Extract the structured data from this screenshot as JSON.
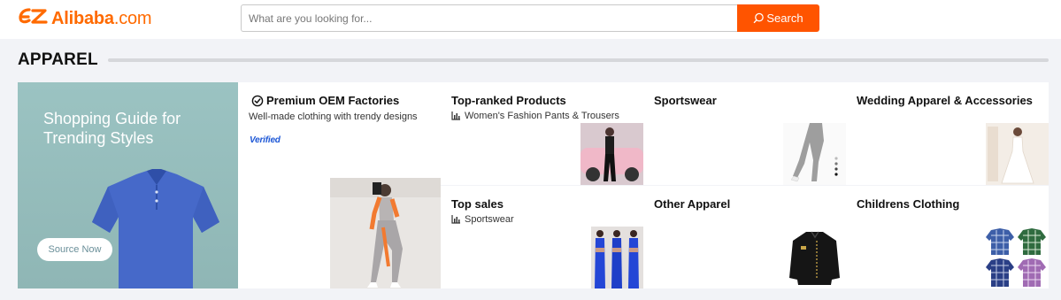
{
  "header": {
    "logo_mark": "Ɛ",
    "logo_name": "Alibaba",
    "logo_domain": ".com",
    "search_placeholder": "What are you looking for...",
    "search_button": "Search"
  },
  "section": {
    "title": "APPAREL"
  },
  "banner": {
    "title": "Shopping Guide for Trending Styles",
    "button": "Source Now"
  },
  "oem_card": {
    "title": "Premium OEM Factories",
    "subtitle": "Well-made clothing with trendy designs",
    "badge": "Verified"
  },
  "cards": [
    {
      "title": "Top-ranked Products",
      "subtitle": "Women's Fashion Pants & Trousers"
    },
    {
      "title": "Sportswear",
      "subtitle": ""
    },
    {
      "title": "Wedding Apparel & Accessories",
      "subtitle": ""
    },
    {
      "title": "Top sales",
      "subtitle": "Sportswear"
    },
    {
      "title": "Other Apparel",
      "subtitle": ""
    },
    {
      "title": "Childrens Clothing",
      "subtitle": ""
    }
  ],
  "colors": {
    "brand": "#ff6a00",
    "search_button": "#ff5400",
    "banner_bg": "#94bcbb",
    "verified": "#1d57d6"
  }
}
